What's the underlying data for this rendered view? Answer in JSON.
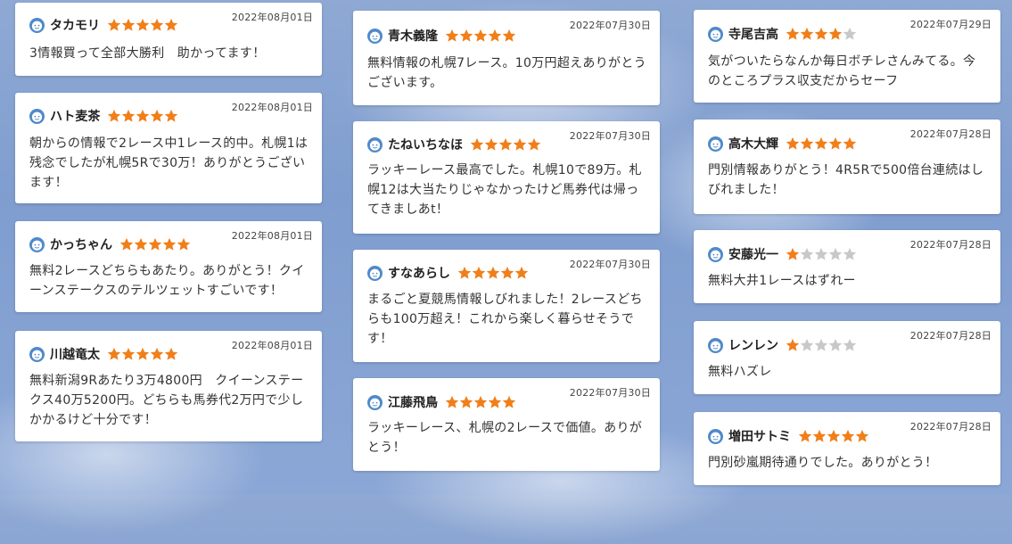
{
  "colors": {
    "star_on": "#f07f1a",
    "star_off": "#c8c8c8",
    "avatar": "#4f8ac9"
  },
  "reviews": [
    {
      "name": "タカモリ",
      "date": "2022年08月01日",
      "rating": 5,
      "text": "3情報買って全部大勝利　助かってます！"
    },
    {
      "name": "ハト麦茶",
      "date": "2022年08月01日",
      "rating": 5,
      "text": "朝からの情報で2レース中1レース的中。札幌1は残念でしたが札幌5Rで30万！ありがとうございます！"
    },
    {
      "name": "かっちゃん",
      "date": "2022年08月01日",
      "rating": 5,
      "text": "無料2レースどちらもあたり。ありがとう！クイーンステークスのテルツェットすごいです！"
    },
    {
      "name": "川越竜太",
      "date": "2022年08月01日",
      "rating": 5,
      "text": "無料新潟9Rあたり3万4800円　クイーンステークス40万5200円。どちらも馬券代2万円で少しかかるけど十分です！"
    },
    {
      "name": "青木義隆",
      "date": "2022年07月30日",
      "rating": 5,
      "text": "無料情報の札幌7レース。10万円超えありがとうございます。"
    },
    {
      "name": "たねいちなほ",
      "date": "2022年07月30日",
      "rating": 5,
      "text": "ラッキーレース最高でした。札幌10で89万。札幌12は大当たりじゃなかったけど馬券代は帰ってきましあt！"
    },
    {
      "name": "すなあらし",
      "date": "2022年07月30日",
      "rating": 5,
      "text": "まるごと夏競馬情報しびれました！2レースどちらも100万超え！これから楽しく暮らせそうです！"
    },
    {
      "name": "江藤飛鳥",
      "date": "2022年07月30日",
      "rating": 5,
      "text": "ラッキーレース、札幌の2レースで価値。ありがとう！"
    },
    {
      "name": "寺尾吉高",
      "date": "2022年07月29日",
      "rating": 4,
      "text": "気がついたらなんか毎日ボチレさんみてる。今のところプラス収支だからセーフ"
    },
    {
      "name": "高木大輝",
      "date": "2022年07月28日",
      "rating": 5,
      "text": "門別情報ありがとう！4R5Rで500倍台連続はしびれました！"
    },
    {
      "name": "安藤光一",
      "date": "2022年07月28日",
      "rating": 1,
      "text": "無料大井1レースはずれー"
    },
    {
      "name": "レンレン",
      "date": "2022年07月28日",
      "rating": 1,
      "text": "無料ハズレ"
    },
    {
      "name": "増田サトミ",
      "date": "2022年07月28日",
      "rating": 5,
      "text": "門別砂嵐期待通りでした。ありがとう！"
    }
  ]
}
